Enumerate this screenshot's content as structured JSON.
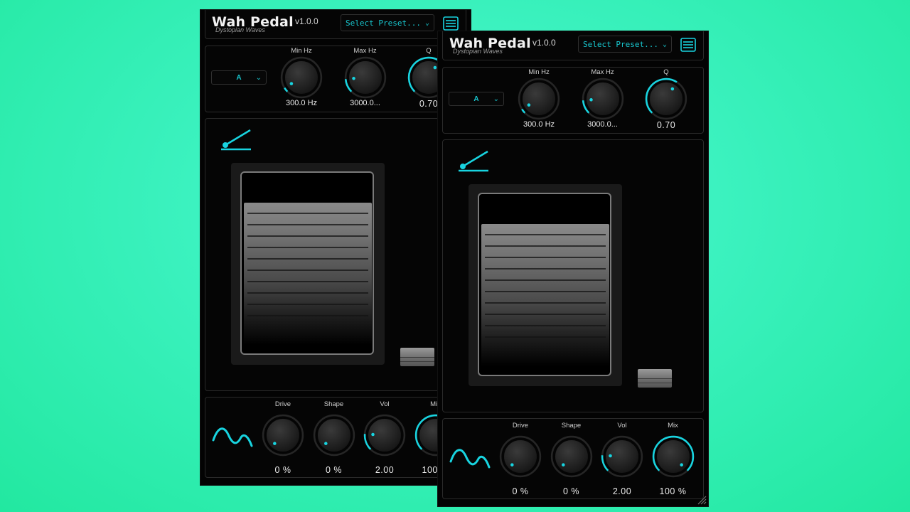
{
  "app": {
    "title": "Wah Pedal",
    "subtitle": "Dystopian Waves",
    "version": "v1.0.0",
    "preset_placeholder": "Select Preset...",
    "accent": "#18d4e0"
  },
  "mode": {
    "selected": "A"
  },
  "top_knobs": [
    {
      "label": "Min Hz",
      "value": "300.0 Hz",
      "level": 0.05
    },
    {
      "label": "Max Hz",
      "value": "3000.0...",
      "level": 0.15
    },
    {
      "label": "Q",
      "value": "0.70",
      "level": 0.62
    }
  ],
  "bottom_knobs": [
    {
      "label": "Drive",
      "value": "0 %",
      "level": 0.0
    },
    {
      "label": "Shape",
      "value": "0 %",
      "level": 0.0
    },
    {
      "label": "Vol",
      "value": "2.00",
      "level": 0.18
    },
    {
      "label": "Mix",
      "value": "100 %",
      "level": 1.0
    }
  ]
}
